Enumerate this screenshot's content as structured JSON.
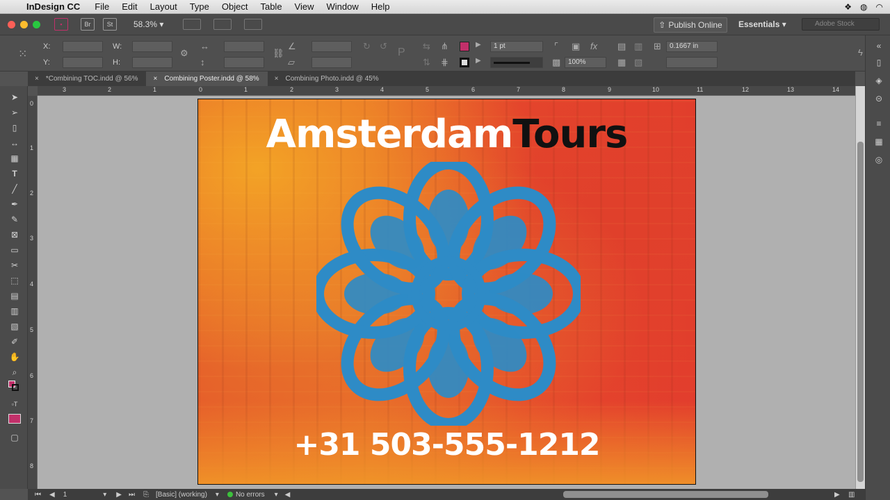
{
  "menubar": {
    "app_name": "InDesign CC",
    "items": [
      "File",
      "Edit",
      "Layout",
      "Type",
      "Object",
      "Table",
      "View",
      "Window",
      "Help"
    ]
  },
  "appbar": {
    "bridge_label": "Br",
    "stock_label": "St",
    "zoom_value": "58.3%",
    "publish_label": "Publish Online",
    "workspace_label": "Essentials",
    "search_placeholder": "Adobe Stock"
  },
  "control": {
    "x_label": "X:",
    "y_label": "Y:",
    "w_label": "W:",
    "h_label": "H:",
    "stroke_weight": "1 pt",
    "opacity": "100%",
    "offset_value": "0.1667 in",
    "fill_color": "#c2306a"
  },
  "tabs": [
    {
      "label": "*Combining TOC.indd @ 56%"
    },
    {
      "label": "Combining Poster.indd @ 58%"
    },
    {
      "label": "Combining Photo.indd @ 45%"
    }
  ],
  "ruler": {
    "h_labels": [
      "3",
      "2",
      "1",
      "0",
      "1",
      "2",
      "3",
      "4",
      "5",
      "6",
      "7",
      "8",
      "9",
      "10",
      "11",
      "12",
      "13",
      "14"
    ],
    "v_labels": [
      "0",
      "1",
      "2",
      "3",
      "4",
      "5",
      "6",
      "7",
      "8"
    ]
  },
  "poster": {
    "title_white": "Amsterdam",
    "title_black": "Tours",
    "phone": "+31 503-555-1212",
    "flower_color": "#2e8bc6",
    "background_red": "#e4402c",
    "background_orange": "#f0962a"
  },
  "status": {
    "page_number": "1",
    "preflight_profile": "[Basic] (working)",
    "errors_label": "No errors"
  }
}
